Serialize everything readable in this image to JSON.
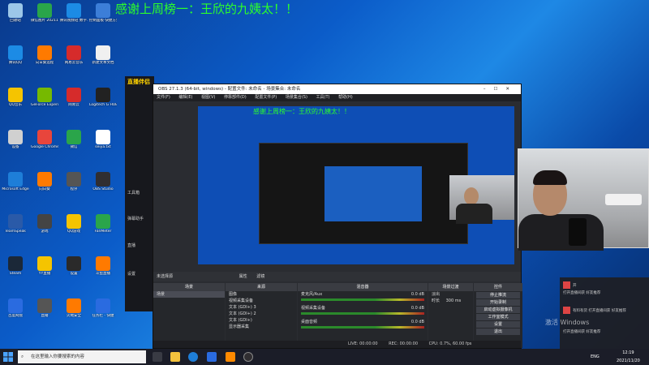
{
  "banner": "感谢上周榜一：王欣的九姨太！！",
  "desktop_icons": [
    {
      "label": "回收站",
      "color": "#9cc7e8"
    },
    {
      "label": "微信图片 2021111...",
      "color": "#2aa54a"
    },
    {
      "label": "腾讯视频轻 数字...",
      "color": "#1c8be5"
    },
    {
      "label": "控制面板·快捷方式",
      "color": "#3c7ed8"
    },
    {
      "label": "腾讯QQ",
      "color": "#1c8be5"
    },
    {
      "label": "向日葵远程",
      "color": "#ff7a00"
    },
    {
      "label": "网易云音乐",
      "color": "#d62b2b"
    },
    {
      "label": "新建文本文档",
      "color": "#f0f0f0"
    },
    {
      "label": "QQ音乐",
      "color": "#f5c400"
    },
    {
      "label": "GeForce Experience",
      "color": "#76b900"
    },
    {
      "label": "网易云",
      "color": "#d62b2b"
    },
    {
      "label": "Logitech G HUB",
      "color": "#222222"
    },
    {
      "label": "设备",
      "color": "#d0d0d0"
    },
    {
      "label": "Google Chrome",
      "color": "#e8453c"
    },
    {
      "label": "微信",
      "color": "#2aa54a"
    },
    {
      "label": "seiya.txt",
      "color": "#ffffff"
    },
    {
      "label": "Microsoft Edge",
      "color": "#1e7ed8"
    },
    {
      "label": "向日葵",
      "color": "#ff7a00"
    },
    {
      "label": "程序",
      "color": "#555555"
    },
    {
      "label": "OBS Studio",
      "color": "#302e31"
    },
    {
      "label": "TeamSpeak",
      "color": "#2a5aa8"
    },
    {
      "label": "游戏",
      "color": "#444444"
    },
    {
      "label": "QQ游戏",
      "color": "#f5c400"
    },
    {
      "label": "FanMeter",
      "color": "#2aa54a"
    },
    {
      "label": "Steam",
      "color": "#1b2838"
    },
    {
      "label": "YY直播",
      "color": "#f5c400"
    },
    {
      "label": "设置",
      "color": "#2a2a2a"
    },
    {
      "label": "斗鱼直播",
      "color": "#ff7a00"
    },
    {
      "label": "百度网盘",
      "color": "#2a6be0"
    },
    {
      "label": "直播",
      "color": "#555555"
    },
    {
      "label": "火绒安全",
      "color": "#ff7a00"
    },
    {
      "label": "任务栏 - 快捷",
      "color": "#2a6be0"
    }
  ],
  "streaming_app": {
    "logo": "直播伴侣",
    "items": [
      "工具箱",
      "弹幕助手",
      "直播",
      "设置"
    ]
  },
  "obs": {
    "title": "OBS 27.1.3 (64-bit, windows) - 配置文件: 未命名 - 场景集合: 未命名",
    "menu": [
      "文件(F)",
      "编辑(E)",
      "视图(V)",
      "停靠部件(D)",
      "配置文件(P)",
      "场景集合(S)",
      "工具(T)",
      "帮助(H)"
    ],
    "preview_banner": "感谢上周榜一：王欣的九姨太！！",
    "no_source_label": "未选择源",
    "properties_btn": "属性",
    "filters_btn": "滤镜",
    "docks": {
      "scenes": {
        "title": "场景",
        "items": [
          "场景"
        ]
      },
      "sources": {
        "title": "来源",
        "items": [
          "图像",
          "视频采集设备",
          "文本 (GDI+) 3",
          "文本 (GDI+) 2",
          "文本 (GDI+)",
          "显示器采集"
        ]
      },
      "mixer": {
        "title": "混音器",
        "channels": [
          {
            "name": "麦克风/Aux",
            "level": "0.0 dB"
          },
          {
            "name": "视频采集设备",
            "level": "0.0 dB"
          },
          {
            "name": "桌面音频",
            "level": "0.0 dB"
          }
        ]
      },
      "transitions": {
        "title": "场景过渡",
        "type": "淡出",
        "duration_label": "时长",
        "duration": "300 ms"
      },
      "controls": {
        "title": "控件",
        "buttons": [
          "停止推流",
          "开始录制",
          "启动虚拟摄像机",
          "工作室模式",
          "设置",
          "退出"
        ]
      }
    },
    "status": {
      "live": "LIVE: 00:00:00",
      "rec": "REC: 00:00:00",
      "cpu": "CPU: 0.7%, 60.00 fps"
    }
  },
  "chat": {
    "messages": [
      "开",
      "打开直播间获 好友推荐",
      "有料有货 打开直播间获 好友推荐",
      "打开直播间获 好友推荐"
    ]
  },
  "watermark": "激活 Windows",
  "taskbar": {
    "search_placeholder": "在这里输入你要搜索的内容",
    "tray_lang": "ENG",
    "time": "12:19",
    "date": "2021/11/20"
  }
}
